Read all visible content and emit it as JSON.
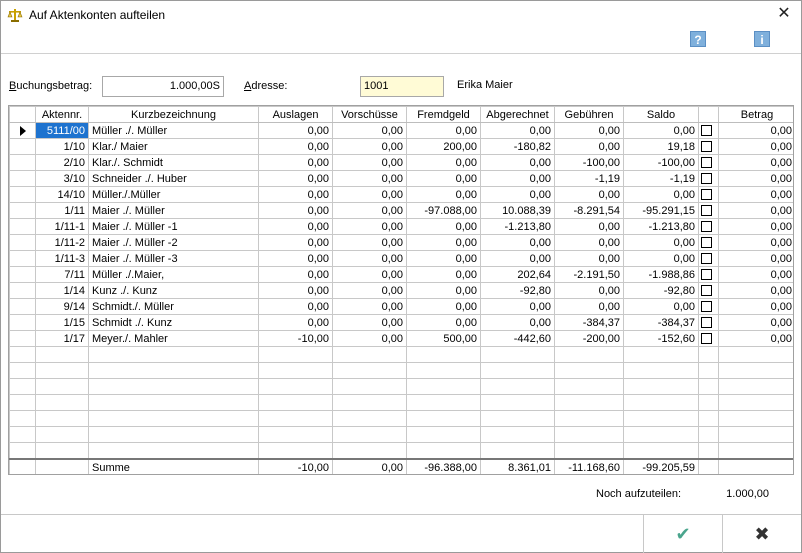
{
  "window": {
    "title": "Auf Aktenkonten aufteilen"
  },
  "toolbar": {
    "help_glyph": "?",
    "info_glyph": "i"
  },
  "form": {
    "buchungsbetrag_label_u": "B",
    "buchungsbetrag_label_rest": "uchungsbetrag:",
    "buchungsbetrag_value": "1.000,00S",
    "adresse_label_u": "A",
    "adresse_label_rest": "dresse:",
    "adresse_value": "1001",
    "adresse_name": "Erika Maier"
  },
  "table": {
    "headers": [
      "",
      "Aktennr.",
      "Kurzbezeichnung",
      "Auslagen",
      "Vorschüsse",
      "Fremdgeld",
      "Abgerechnet",
      "Gebühren",
      "Saldo",
      "",
      "Betrag"
    ],
    "rows": [
      [
        "5111/00",
        "Müller ./. Müller",
        "0,00",
        "0,00",
        "0,00",
        "0,00",
        "0,00",
        "0,00",
        "0,00"
      ],
      [
        "1/10",
        "Klar./ Maier",
        "0,00",
        "0,00",
        "200,00",
        "-180,82",
        "0,00",
        "19,18",
        "0,00"
      ],
      [
        "2/10",
        "Klar./. Schmidt",
        "0,00",
        "0,00",
        "0,00",
        "0,00",
        "-100,00",
        "-100,00",
        "0,00"
      ],
      [
        "3/10",
        "Schneider ./. Huber",
        "0,00",
        "0,00",
        "0,00",
        "0,00",
        "-1,19",
        "-1,19",
        "0,00"
      ],
      [
        "14/10",
        "Müller./.Müller",
        "0,00",
        "0,00",
        "0,00",
        "0,00",
        "0,00",
        "0,00",
        "0,00"
      ],
      [
        "1/11",
        "Maier ./. Müller",
        "0,00",
        "0,00",
        "-97.088,00",
        "10.088,39",
        "-8.291,54",
        "-95.291,15",
        "0,00"
      ],
      [
        "1/11-1",
        "Maier ./. Müller -1",
        "0,00",
        "0,00",
        "0,00",
        "-1.213,80",
        "0,00",
        "-1.213,80",
        "0,00"
      ],
      [
        "1/11-2",
        "Maier ./. Müller -2",
        "0,00",
        "0,00",
        "0,00",
        "0,00",
        "0,00",
        "0,00",
        "0,00"
      ],
      [
        "1/11-3",
        "Maier ./. Müller -3",
        "0,00",
        "0,00",
        "0,00",
        "0,00",
        "0,00",
        "0,00",
        "0,00"
      ],
      [
        "7/11",
        "Müller ./.Maier,",
        "0,00",
        "0,00",
        "0,00",
        "202,64",
        "-2.191,50",
        "-1.988,86",
        "0,00"
      ],
      [
        "1/14",
        "Kunz ./. Kunz",
        "0,00",
        "0,00",
        "0,00",
        "-92,80",
        "0,00",
        "-92,80",
        "0,00"
      ],
      [
        "9/14",
        "Schmidt./. Müller",
        "0,00",
        "0,00",
        "0,00",
        "0,00",
        "0,00",
        "0,00",
        "0,00"
      ],
      [
        "1/15",
        "Schmidt ./. Kunz",
        "0,00",
        "0,00",
        "0,00",
        "0,00",
        "-384,37",
        "-384,37",
        "0,00"
      ],
      [
        "1/17",
        "Meyer./. Mahler",
        "-10,00",
        "0,00",
        "500,00",
        "-442,60",
        "-200,00",
        "-152,60",
        "0,00"
      ]
    ],
    "sum": {
      "label": "Summe",
      "auslagen": "-10,00",
      "vorschuesse": "0,00",
      "fremdgeld": "-96.388,00",
      "abgerechnet": "8.361,01",
      "gebuehren": "-11.168,60",
      "saldo": "-99.205,59",
      "betrag": ""
    }
  },
  "footer": {
    "rest_label": "Noch aufzuteilen:",
    "rest_value": "1.000,00",
    "ok_glyph": "✔",
    "cancel_glyph": "✖"
  }
}
